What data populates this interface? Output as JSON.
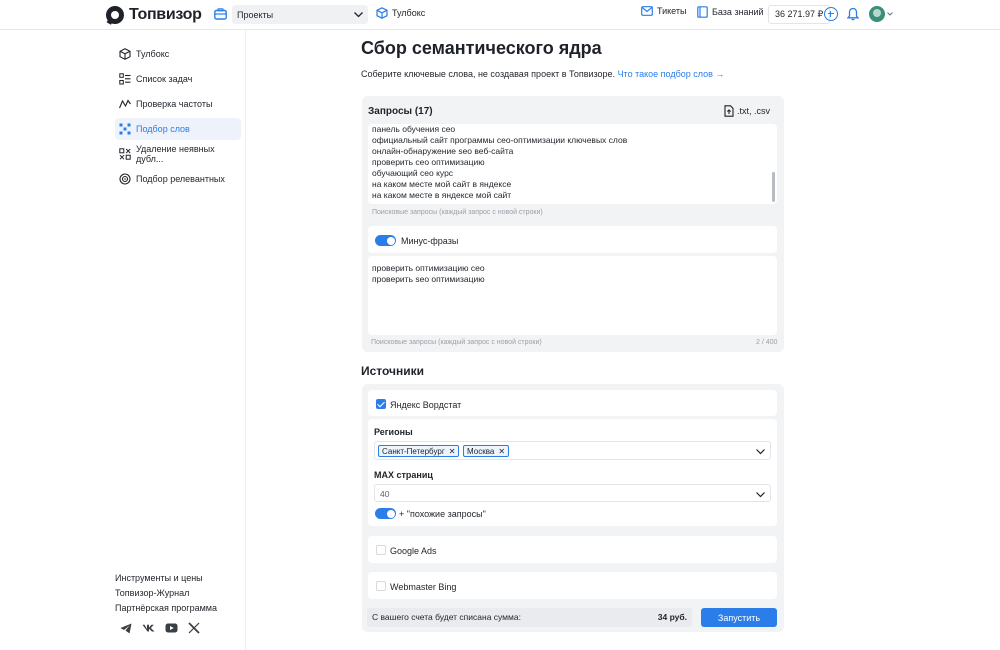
{
  "header": {
    "logo_text": "Топвизор",
    "project_select": "Проекты",
    "toolbox_label": "Тулбокс",
    "tickets_label": "Тикеты",
    "knowledge_label": "База знаний",
    "balance": "36 271.97 ₽"
  },
  "sidebar": {
    "items": [
      {
        "label": "Тулбокс",
        "icon": "cube-icon"
      },
      {
        "label": "Список задач",
        "icon": "task-list-icon"
      },
      {
        "label": "Проверка частоты",
        "icon": "frequency-icon"
      },
      {
        "label": "Подбор слов",
        "icon": "word-selection-icon",
        "active": true
      },
      {
        "label": "Удаление неявных дубл...",
        "icon": "duplicates-icon"
      },
      {
        "label": "Подбор релевантных",
        "icon": "target-icon"
      }
    ],
    "footer": [
      "Инструменты и цены",
      "Топвизор-Журнал",
      "Партнёрская программа"
    ]
  },
  "main": {
    "title": "Сбор семантического ядра",
    "subtitle": "Соберите ключевые слова, не создавая проект в Топвизоре.",
    "subtitle_link": "Что такое подбор слов →",
    "queries": {
      "title": "Запросы (17)",
      "file_label": ".txt, .csv",
      "lines": [
        "панель обучения сео",
        "официальный сайт программы сео-оптимизации ключевых слов",
        "онлайн-обнаружение seo веб-сайта",
        "проверить сео оптимизацию",
        "обучающий сео курс",
        "на каком месте мой сайт в яндексе",
        "на каком месте в яндексе мой сайт"
      ],
      "hint": "Поисковые запросы (каждый запрос с новой строки)"
    },
    "minus": {
      "toggle_label": "Минус-фразы",
      "lines": [
        "проверить оптимизацию сео",
        "проверить seo оптимизацию"
      ],
      "hint": "Поисковые запросы (каждый запрос с новой строки)",
      "counter": "2 / 400"
    },
    "sources": {
      "title": "Источники",
      "yandex_label": "Яндекс Вордстат",
      "regions_label": "Регионы",
      "regions": [
        "Санкт-Петербург",
        "Москва"
      ],
      "max_pages_label": "MAX страниц",
      "max_pages_value": "40",
      "similar_label": "+ \"похожие запросы\"",
      "google_label": "Google Ads",
      "bing_label": "Webmaster Bing"
    },
    "cost_label": "С вашего счета будет списана сумма:",
    "cost_value": "34 руб.",
    "run_label": "Запустить"
  },
  "colors": {
    "accent": "#2b7de9",
    "text": "#1f2329",
    "panel": "#f2f3f5"
  }
}
